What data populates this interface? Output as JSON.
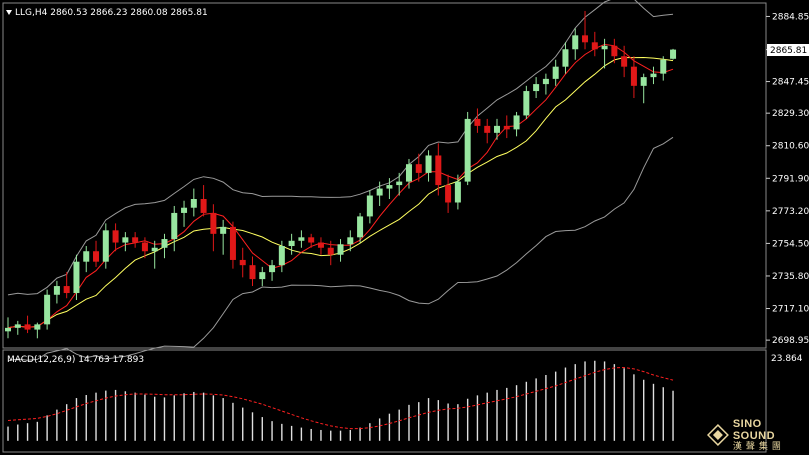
{
  "window_title": "LLG,H4  2860.53 2866.23 2860.08 2865.81",
  "macd_label": "MACD(12,26,9) 14.763 17.893",
  "macd_axis_label": "23.864",
  "price_tag": "2865.81",
  "logo": {
    "line1": "SINO SOUND",
    "line2": "漢聲集團"
  },
  "colors": {
    "up": "#98e6a0",
    "down": "#e01818",
    "ma_fast": "#ff2020",
    "ma_slow": "#ffff60",
    "band": "#9a9a9a",
    "signal": "#ff2020",
    "hist": "#e0e0e0",
    "tag_bg": "#ffffff"
  },
  "chart_data": {
    "type": "candlestick",
    "title": "LLG,H4",
    "ohlc_header": [
      2860.53,
      2866.23,
      2860.08,
      2865.81
    ],
    "ylim": [
      2695,
      2892
    ],
    "y_ticks": [
      "2884.85",
      "2865.81",
      "2847.45",
      "2829.30",
      "2810.60",
      "2791.90",
      "2773.20",
      "2754.50",
      "2735.80",
      "2717.10",
      "2698.95"
    ],
    "y_tick_values": [
      2884.85,
      2865.81,
      2847.45,
      2829.3,
      2810.6,
      2791.9,
      2773.2,
      2754.5,
      2735.8,
      2717.1,
      2698.95
    ],
    "candles": [
      [
        2704,
        2712,
        2700,
        2706
      ],
      [
        2706,
        2710,
        2702,
        2708
      ],
      [
        2708,
        2713,
        2703,
        2705
      ],
      [
        2705,
        2709,
        2700,
        2708
      ],
      [
        2708,
        2728,
        2705,
        2725
      ],
      [
        2725,
        2733,
        2720,
        2730
      ],
      [
        2730,
        2738,
        2723,
        2726
      ],
      [
        2726,
        2748,
        2722,
        2744
      ],
      [
        2744,
        2753,
        2738,
        2750
      ],
      [
        2750,
        2756,
        2741,
        2744
      ],
      [
        2744,
        2766,
        2740,
        2762
      ],
      [
        2762,
        2766,
        2750,
        2755
      ],
      [
        2755,
        2761,
        2750,
        2758
      ],
      [
        2758,
        2761,
        2752,
        2755
      ],
      [
        2755,
        2758,
        2746,
        2750
      ],
      [
        2750,
        2756,
        2740,
        2752
      ],
      [
        2752,
        2760,
        2746,
        2757
      ],
      [
        2757,
        2776,
        2750,
        2772
      ],
      [
        2772,
        2779,
        2764,
        2775
      ],
      [
        2775,
        2786,
        2770,
        2780
      ],
      [
        2780,
        2788,
        2770,
        2772
      ],
      [
        2772,
        2777,
        2750,
        2760
      ],
      [
        2760,
        2768,
        2748,
        2764
      ],
      [
        2764,
        2767,
        2740,
        2745
      ],
      [
        2745,
        2752,
        2735,
        2742
      ],
      [
        2742,
        2747,
        2730,
        2734
      ],
      [
        2734,
        2741,
        2730,
        2738
      ],
      [
        2738,
        2745,
        2733,
        2742
      ],
      [
        2742,
        2756,
        2738,
        2753
      ],
      [
        2753,
        2760,
        2748,
        2756
      ],
      [
        2756,
        2762,
        2752,
        2758
      ],
      [
        2758,
        2760,
        2752,
        2755
      ],
      [
        2755,
        2758,
        2748,
        2752
      ],
      [
        2752,
        2756,
        2742,
        2748
      ],
      [
        2748,
        2757,
        2744,
        2754
      ],
      [
        2754,
        2762,
        2750,
        2758
      ],
      [
        2758,
        2772,
        2755,
        2770
      ],
      [
        2770,
        2785,
        2766,
        2782
      ],
      [
        2782,
        2790,
        2776,
        2786
      ],
      [
        2786,
        2792,
        2780,
        2788
      ],
      [
        2788,
        2795,
        2782,
        2790
      ],
      [
        2790,
        2803,
        2786,
        2800
      ],
      [
        2800,
        2806,
        2790,
        2795
      ],
      [
        2795,
        2808,
        2790,
        2805
      ],
      [
        2805,
        2812,
        2782,
        2788
      ],
      [
        2788,
        2794,
        2772,
        2778
      ],
      [
        2778,
        2794,
        2774,
        2790
      ],
      [
        2790,
        2830,
        2788,
        2826
      ],
      [
        2826,
        2832,
        2818,
        2822
      ],
      [
        2822,
        2826,
        2812,
        2818
      ],
      [
        2818,
        2826,
        2814,
        2822
      ],
      [
        2822,
        2828,
        2815,
        2820
      ],
      [
        2820,
        2830,
        2816,
        2828
      ],
      [
        2828,
        2845,
        2826,
        2842
      ],
      [
        2842,
        2850,
        2838,
        2846
      ],
      [
        2846,
        2852,
        2840,
        2849
      ],
      [
        2849,
        2860,
        2845,
        2856
      ],
      [
        2856,
        2870,
        2852,
        2866
      ],
      [
        2866,
        2878,
        2860,
        2874
      ],
      [
        2874,
        2888,
        2866,
        2870
      ],
      [
        2870,
        2876,
        2862,
        2866
      ],
      [
        2866,
        2872,
        2855,
        2868
      ],
      [
        2868,
        2872,
        2858,
        2862
      ],
      [
        2862,
        2868,
        2850,
        2856
      ],
      [
        2856,
        2862,
        2838,
        2845
      ],
      [
        2845,
        2852,
        2835,
        2850
      ],
      [
        2850,
        2856,
        2846,
        2852
      ],
      [
        2852,
        2862,
        2848,
        2860
      ],
      [
        2860.53,
        2866.23,
        2860.08,
        2865.81
      ]
    ],
    "macd_histogram": [
      4.2,
      4.8,
      5.2,
      5.6,
      7.5,
      9.2,
      10.8,
      12.6,
      13.5,
      14.2,
      14.8,
      15.0,
      14.6,
      14.2,
      13.6,
      13.0,
      12.8,
      13.4,
      14.0,
      14.4,
      14.2,
      13.4,
      12.6,
      11.2,
      9.8,
      8.4,
      7.0,
      5.8,
      5.0,
      4.4,
      3.9,
      3.5,
      3.2,
      3.0,
      3.0,
      3.2,
      3.9,
      5.2,
      6.6,
      8.0,
      9.2,
      10.6,
      11.4,
      12.6,
      12.0,
      11.0,
      10.8,
      12.4,
      13.4,
      14.2,
      15.0,
      15.6,
      16.4,
      17.4,
      18.4,
      19.4,
      20.4,
      21.6,
      22.6,
      23.4,
      23.6,
      23.4,
      22.6,
      21.4,
      19.6,
      18.0,
      16.8,
      15.8,
      14.763
    ],
    "macd_signal": [
      6.0,
      6.2,
      6.4,
      6.6,
      7.2,
      8.0,
      9.0,
      10.0,
      11.0,
      11.8,
      12.6,
      13.2,
      13.6,
      13.8,
      13.8,
      13.7,
      13.6,
      13.6,
      13.6,
      13.7,
      13.8,
      13.7,
      13.5,
      13.0,
      12.4,
      11.6,
      10.8,
      9.8,
      8.8,
      7.8,
      6.8,
      5.9,
      5.1,
      4.4,
      3.9,
      3.6,
      3.6,
      3.9,
      4.4,
      5.1,
      5.9,
      6.8,
      7.6,
      8.4,
      9.0,
      9.4,
      9.6,
      10.0,
      10.6,
      11.2,
      11.8,
      12.4,
      13.0,
      13.8,
      14.6,
      15.4,
      16.2,
      17.2,
      18.2,
      19.2,
      20.2,
      21.0,
      21.5,
      21.6,
      21.2,
      20.4,
      19.4,
      18.6,
      17.893
    ],
    "macd_ylim": [
      -3,
      25
    ]
  }
}
